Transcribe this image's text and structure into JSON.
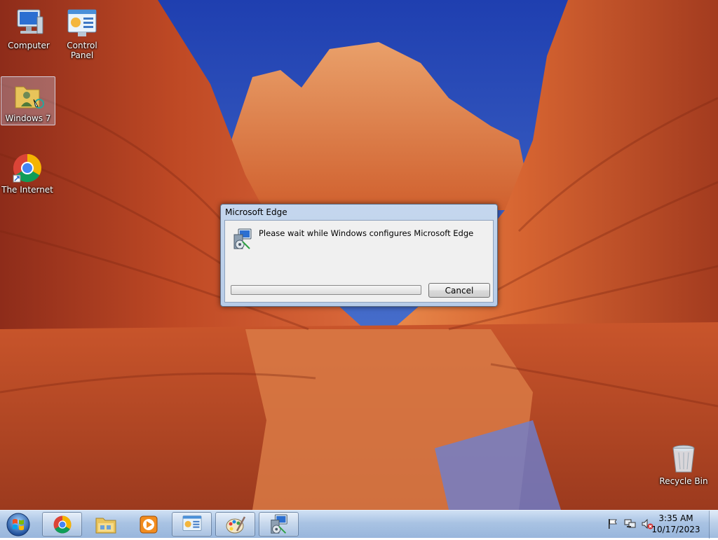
{
  "desktop": {
    "icons": [
      {
        "label": "Computer",
        "icon": "computer-icon"
      },
      {
        "label": "Control Panel",
        "icon": "control-panel-icon"
      },
      {
        "label": "Windows 7",
        "icon": "user-folder-icon",
        "selected": true
      },
      {
        "label": "The Internet",
        "icon": "chrome-icon"
      },
      {
        "label": "Recycle Bin",
        "icon": "recycle-bin-icon"
      }
    ]
  },
  "dialog": {
    "title": "Microsoft Edge",
    "message": "Please wait while Windows configures Microsoft Edge",
    "progress": 0,
    "cancel_label": "Cancel",
    "icon": "installer-icon"
  },
  "taskbar": {
    "start_icon": "windows-start-icon",
    "buttons": [
      {
        "icon": "chrome-icon",
        "open": true
      },
      {
        "icon": "file-explorer-icon",
        "open": false
      },
      {
        "icon": "media-player-icon",
        "open": false
      },
      {
        "icon": "control-panel-icon",
        "open": true
      },
      {
        "icon": "paint-icon",
        "open": true
      },
      {
        "icon": "installer-icon",
        "open": true
      }
    ],
    "tray": {
      "icons": [
        "action-center-flag-icon",
        "network-icon",
        "volume-muted-icon"
      ],
      "time": "3:35 AM",
      "date": "10/17/2023"
    }
  },
  "colors": {
    "sky": "#2f55c8",
    "rock": "#c8502a",
    "taskbar": "#a9c3e3",
    "dialog_frame": "#b7cce8"
  }
}
